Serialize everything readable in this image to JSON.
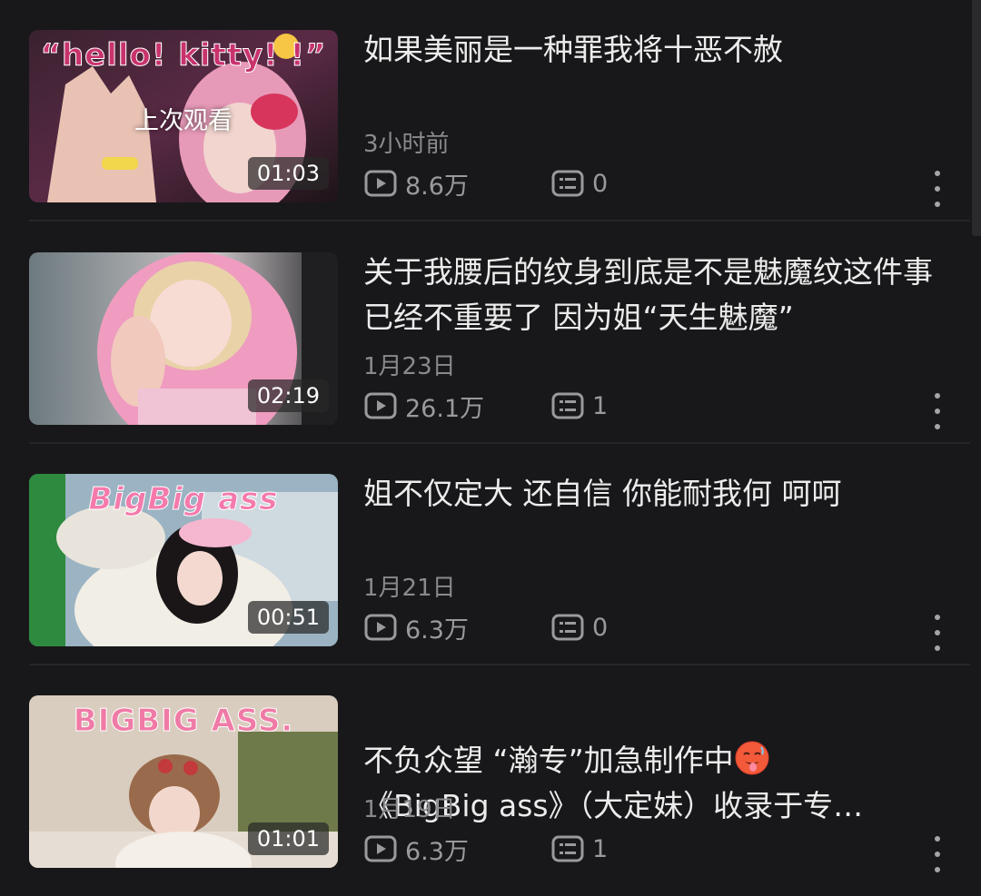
{
  "colors": {
    "background": "#18181a",
    "title_text": "#ececec",
    "meta_text": "#8a8a8c",
    "divider": "#262628"
  },
  "videos": [
    {
      "thumbnail_caption": "“hello! kitty! !”",
      "watched_label": "上次观看",
      "duration": "01:03",
      "title": "如果美丽是一种罪我将十恶不赦",
      "date": "3小时前",
      "views": "8.6万",
      "comments": "0",
      "view_icon": "play-icon",
      "comment_icon": "comment-icon"
    },
    {
      "duration": "02:19",
      "title": "关于我腰后的纹身到底是不是魅魔纹这件事 已经不重要了 因为姐“天生魅魔”",
      "date": "1月23日",
      "views": "26.1万",
      "comments": "1",
      "view_icon": "play-icon",
      "comment_icon": "comment-icon"
    },
    {
      "thumbnail_caption": "BigBig ass",
      "duration": "00:51",
      "title": "姐不仅定大 还自信 你能耐我何 呵呵",
      "date": "1月21日",
      "views": "6.3万",
      "comments": "0",
      "view_icon": "play-icon",
      "comment_icon": "comment-icon"
    },
    {
      "thumbnail_caption": "BIGBIG ASS.",
      "duration": "01:01",
      "title_line1": "不负众望 “瀚专”加急制作中",
      "title_emoji": "hot-face-emoji",
      "title_line2": "《BigBig ass》（大定妹）收录于专…",
      "date": "1月19日",
      "views": "6.3万",
      "comments": "1",
      "view_icon": "play-icon",
      "comment_icon": "comment-icon"
    }
  ]
}
